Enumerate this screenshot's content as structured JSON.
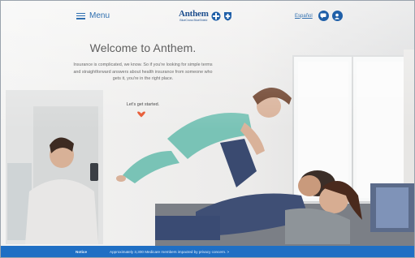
{
  "header": {
    "menu_label": "Menu",
    "logo_word": "Anthem",
    "logo_sub": "BlueCross BlueShield",
    "language_link": "Español",
    "icons": [
      "menu-icon",
      "blue-cross-icon",
      "blue-shield-icon",
      "chat-icon",
      "user-icon"
    ]
  },
  "hero": {
    "title": "Welcome to Anthem.",
    "body": "Insurance is complicated, we know. So if you're looking for simple terms and straightforward answers about health insurance from someone who gets it, you're in the right place.",
    "cta": "Let's get started."
  },
  "notice": {
    "label": "Notice",
    "message": "Approximately 3,300 Medicare members impacted by privacy concern. >"
  },
  "colors": {
    "brand_blue": "#1f5fa8",
    "accent_heart": "#e8603c",
    "notice_bar": "#1f6fc4"
  }
}
